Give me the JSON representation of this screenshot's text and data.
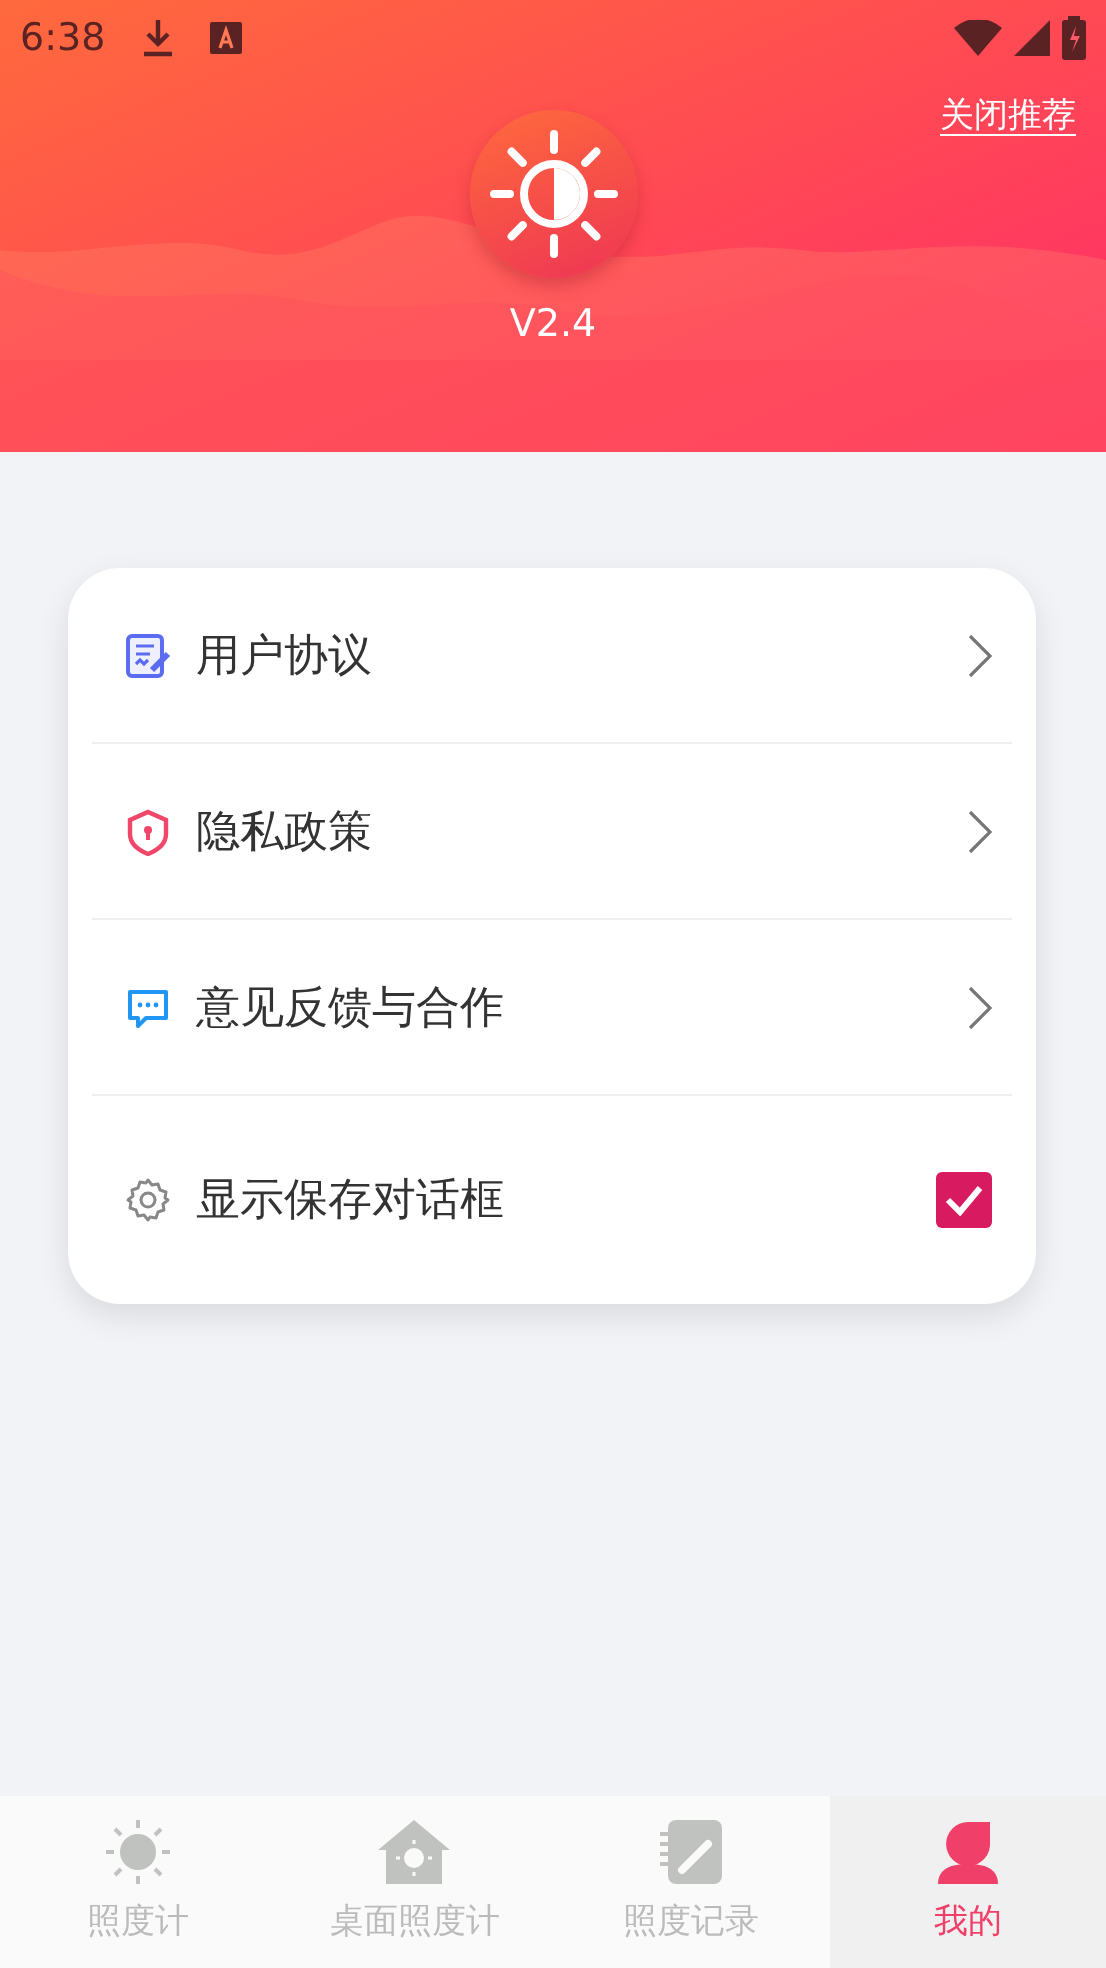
{
  "status_bar": {
    "time": "6:38"
  },
  "header": {
    "close_link": "关闭推荐",
    "version": "V2.4"
  },
  "menu": [
    {
      "kind": "link",
      "label": "用户协议"
    },
    {
      "kind": "link",
      "label": "隐私政策"
    },
    {
      "kind": "link",
      "label": "意见反馈与合作"
    },
    {
      "kind": "toggle",
      "label": "显示保存对话框",
      "checked": true
    }
  ],
  "bottom_nav": [
    {
      "label": "照度计",
      "selected": false
    },
    {
      "label": "桌面照度计",
      "selected": false
    },
    {
      "label": "照度记录",
      "selected": false
    },
    {
      "label": "我的",
      "selected": true
    }
  ]
}
